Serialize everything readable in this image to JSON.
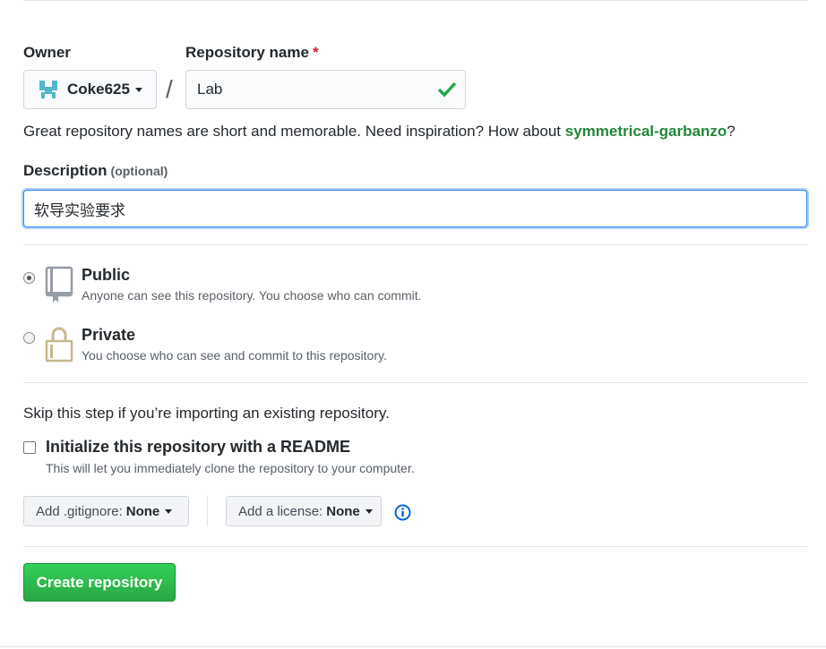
{
  "owner": {
    "label": "Owner",
    "value": "Coke625"
  },
  "separator": "/",
  "repo": {
    "label": "Repository name",
    "required_mark": "*",
    "value": "Lab"
  },
  "hint": {
    "prefix": "Great repository names are short and memorable. Need inspiration? How about ",
    "suggestion": "symmetrical-garbanzo",
    "suffix": "?"
  },
  "description": {
    "label": "Description",
    "optional": "(optional)",
    "value": "软导实验要求"
  },
  "visibility": {
    "public": {
      "title": "Public",
      "desc": "Anyone can see this repository. You choose who can commit.",
      "selected": true
    },
    "private": {
      "title": "Private",
      "desc": "You choose who can see and commit to this repository.",
      "selected": false
    }
  },
  "skip_text": "Skip this step if you’re importing an existing repository.",
  "readme": {
    "title": "Initialize this repository with a README",
    "desc": "This will let you immediately clone the repository to your computer.",
    "checked": false
  },
  "gitignore": {
    "label": "Add .gitignore:",
    "value": "None"
  },
  "license": {
    "label": "Add a license:",
    "value": "None"
  },
  "create_button": "Create repository",
  "colors": {
    "primary_green": "#28a745",
    "focus_blue": "#2188ff",
    "info_blue": "#0366d6",
    "identicon": "#4fb8c9",
    "icon_tan": "#c6b88e"
  }
}
